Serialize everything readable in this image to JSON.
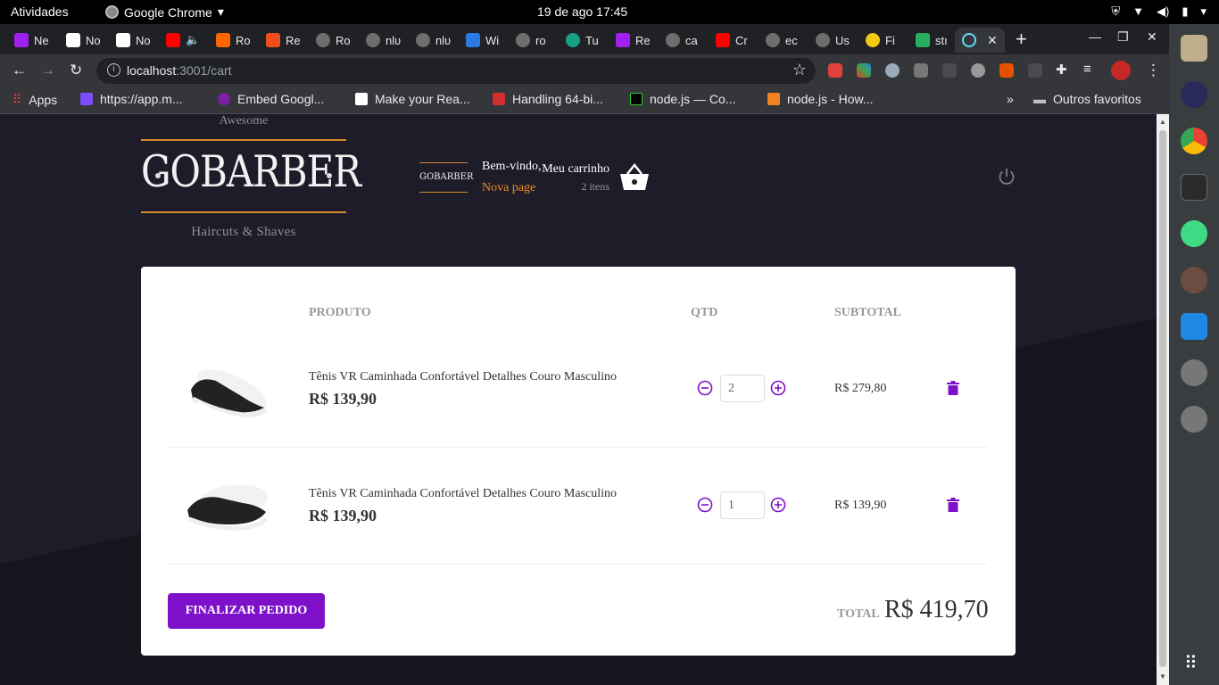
{
  "system": {
    "activities": "Atividades",
    "app_name": "Google Chrome",
    "clock": "19 de ago  17:45"
  },
  "tabs": [
    {
      "label": "Ne",
      "color": "#a020f0"
    },
    {
      "label": "No",
      "color": "#ffffff"
    },
    {
      "label": "No",
      "color": "#ffffff"
    },
    {
      "label": "",
      "color": "#ff0000"
    },
    {
      "label": "Ro",
      "color": "#ff6600"
    },
    {
      "label": "Re",
      "color": "#f24e1e"
    },
    {
      "label": "Ro",
      "color": "#6e6e6e"
    },
    {
      "label": "nlʋ",
      "color": "#6e6e6e"
    },
    {
      "label": "nlʋ",
      "color": "#6e6e6e"
    },
    {
      "label": "Wi",
      "color": "#2a7ae2"
    },
    {
      "label": "ro",
      "color": "#6e6e6e"
    },
    {
      "label": "Tu",
      "color": "#16a085"
    },
    {
      "label": "Re",
      "color": "#a020f0"
    },
    {
      "label": "ca",
      "color": "#6e6e6e"
    },
    {
      "label": "Cr",
      "color": "#ff0000"
    },
    {
      "label": "ec",
      "color": "#6e6e6e"
    },
    {
      "label": "Us",
      "color": "#6e6e6e"
    },
    {
      "label": "Fi",
      "color": "#f2c811"
    },
    {
      "label": "stı",
      "color": "#27ae60"
    }
  ],
  "browser": {
    "url_host": "localhost",
    "url_path": ":3001/cart"
  },
  "bookmarks": {
    "apps": "Apps",
    "items": [
      "https://app.m...",
      "Embed Googl...",
      "Make your Rea...",
      "Handling 64-bi...",
      "node.js — Co...",
      "node.js - How..."
    ],
    "overflow": "»",
    "other": "Outros favoritos"
  },
  "header": {
    "brand_top": "Awesome",
    "brand_logo": "GOBARBER",
    "brand_bottom": "Haircuts & Shaves",
    "mini_logo": "GOBARBER",
    "welcome": "Bem-vindo,",
    "new_page": "Nova page",
    "cart_title": "Meu carrinho",
    "cart_count": "2 itens"
  },
  "cart": {
    "col_product": "PRODUTO",
    "col_qty": "QTD",
    "col_subtotal": "SUBTOTAL",
    "items": [
      {
        "name": "Tênis VR Caminhada Confortável Detalhes Couro Masculino",
        "price": "R$ 139,90",
        "qty": "2",
        "subtotal": "R$ 279,80"
      },
      {
        "name": "Tênis VR Caminhada Confortável Detalhes Couro Masculino",
        "price": "R$ 139,90",
        "qty": "1",
        "subtotal": "R$ 139,90"
      }
    ],
    "finish_label": "FINALIZAR PEDIDO",
    "total_label": "TOTAL",
    "total_value": "R$ 419,70"
  },
  "colors": {
    "accent": "#7d10c8",
    "orange": "#f08c1a",
    "background": "#191920"
  }
}
